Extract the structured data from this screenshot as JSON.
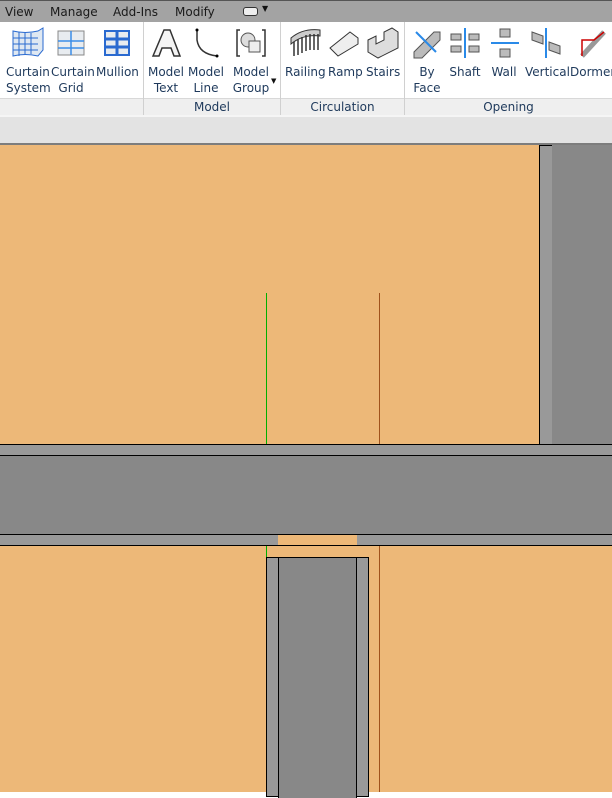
{
  "menu": {
    "tabs": [
      "View",
      "Manage",
      "Add-Ins",
      "Modify"
    ]
  },
  "ribbon": {
    "buttons": [
      {
        "line1": "Curtain",
        "line2": "System"
      },
      {
        "line1": "Curtain",
        "line2": "Grid"
      },
      {
        "line1": "Mullion",
        "line2": ""
      },
      {
        "line1": "Model",
        "line2": "Text"
      },
      {
        "line1": "Model",
        "line2": "Line"
      },
      {
        "line1": "Model",
        "line2": "Group"
      },
      {
        "line1": "Railing",
        "line2": ""
      },
      {
        "line1": "Ramp",
        "line2": ""
      },
      {
        "line1": "Stairs",
        "line2": ""
      },
      {
        "line1": "By",
        "line2": "Face"
      },
      {
        "line1": "Shaft",
        "line2": ""
      },
      {
        "line1": "Wall",
        "line2": ""
      },
      {
        "line1": "Vertical",
        "line2": ""
      },
      {
        "line1": "Dormer",
        "line2": ""
      }
    ],
    "panels": [
      "Model",
      "Circulation",
      "Opening"
    ]
  },
  "colors": {
    "floor": "#edb878",
    "wall": "#888888",
    "wall_edge": "#999999",
    "ref_green": "#00b000",
    "ref_brown": "#a0521c"
  }
}
